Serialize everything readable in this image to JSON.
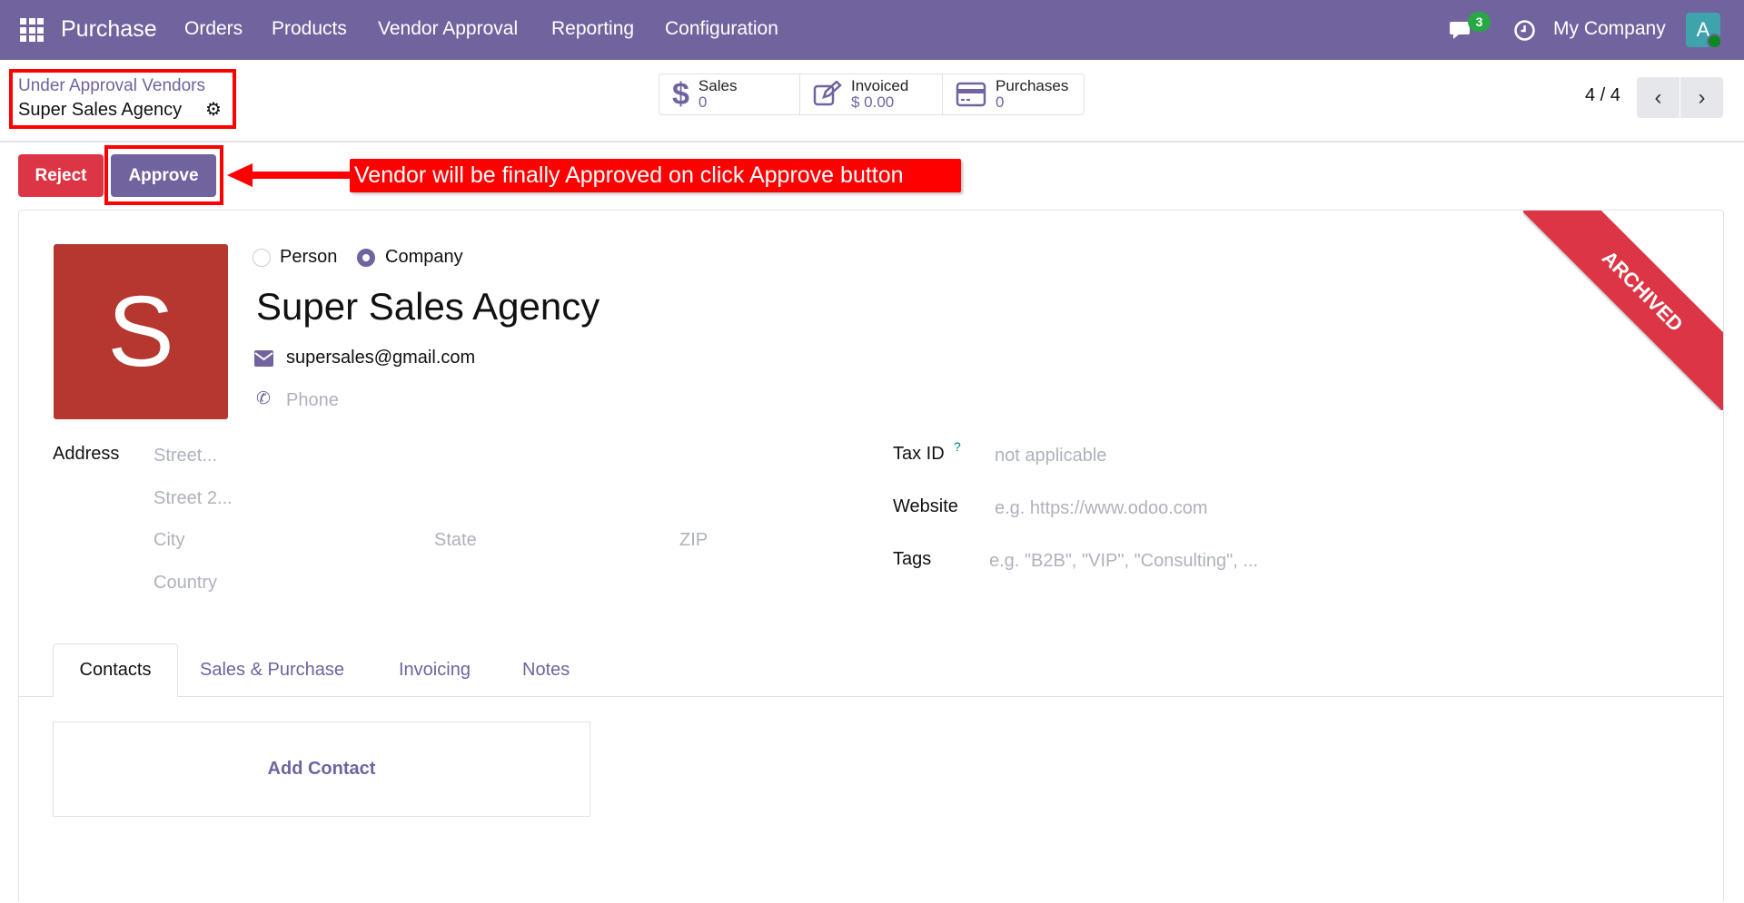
{
  "navbar": {
    "app_name": "Purchase",
    "menu": [
      "Orders",
      "Products",
      "Vendor Approval",
      "Reporting",
      "Configuration"
    ],
    "chat_count": "3",
    "company": "My Company",
    "avatar_letter": "A"
  },
  "breadcrumb": {
    "parent": "Under Approval Vendors",
    "current": "Super Sales Agency"
  },
  "stats": [
    {
      "label": "Sales",
      "value": "0"
    },
    {
      "label": "Invoiced",
      "value": "$ 0.00"
    },
    {
      "label": "Purchases",
      "value": "0"
    }
  ],
  "pager": {
    "text": "4 / 4"
  },
  "actions": {
    "reject": "Reject",
    "approve": "Approve"
  },
  "annotation": "Vendor will be finally Approved on click Approve button",
  "ribbon": "ARCHIVED",
  "partner": {
    "avatar_letter": "S",
    "type_options": [
      "Person",
      "Company"
    ],
    "selected_type": "Company",
    "name": "Super Sales Agency",
    "email": "supersales@gmail.com",
    "phone_placeholder": "Phone"
  },
  "address": {
    "label": "Address",
    "street": "Street...",
    "street2": "Street 2...",
    "city": "City",
    "state": "State",
    "zip": "ZIP",
    "country": "Country"
  },
  "fields": {
    "tax_label": "Tax ID",
    "tax_help": "?",
    "tax_placeholder": "not applicable",
    "website_label": "Website",
    "website_placeholder": "e.g. https://www.odoo.com",
    "tags_label": "Tags",
    "tags_placeholder": "e.g. \"B2B\", \"VIP\", \"Consulting\", ..."
  },
  "tabs": [
    "Contacts",
    "Sales & Purchase",
    "Invoicing",
    "Notes"
  ],
  "add_contact": "Add Contact",
  "colors": {
    "brand": "#71639e",
    "danger": "#dc3545",
    "annotation": "#ff0000"
  }
}
